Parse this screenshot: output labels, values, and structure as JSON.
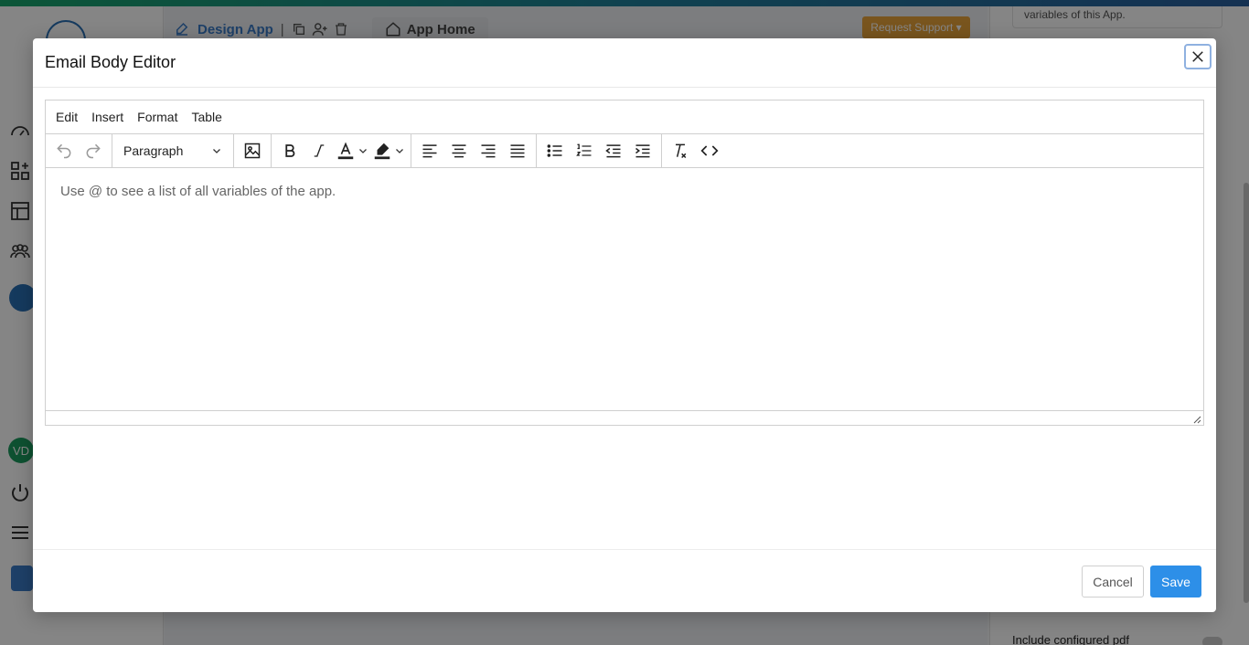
{
  "app": {
    "header": {
      "design_app_label": "Design App",
      "separator": "|",
      "app_home_label": "App Home",
      "request_support_label": "Request Support ▾"
    },
    "right_panel": {
      "card_text": "variables of this App.",
      "footer_text": "Include configured pdf"
    },
    "sidebar": {
      "avatar_initials": "VD"
    }
  },
  "modal": {
    "title": "Email Body Editor",
    "menu": [
      "Edit",
      "Insert",
      "Format",
      "Table"
    ],
    "block_format": "Paragraph",
    "placeholder": "Use @ to see a list of all variables of the app.",
    "cancel_label": "Cancel",
    "save_label": "Save"
  },
  "icons": {
    "undo": "undo-icon",
    "redo": "redo-icon",
    "image": "image-icon",
    "bold": "bold-icon",
    "italic": "italic-icon",
    "text_color": "text-color-icon",
    "highlight": "highlight-color-icon",
    "align_left": "align-left-icon",
    "align_center": "align-center-icon",
    "align_right": "align-right-icon",
    "align_justify": "align-justify-icon",
    "bullet_list": "bullet-list-icon",
    "numbered_list": "numbered-list-icon",
    "outdent": "outdent-icon",
    "indent": "indent-icon",
    "clear_format": "clear-formatting-icon",
    "source_code": "source-code-icon",
    "close": "close-icon"
  },
  "colors": {
    "primary": "#2d8fe8",
    "warning": "#e8a33a",
    "link": "#3a7bc8"
  }
}
